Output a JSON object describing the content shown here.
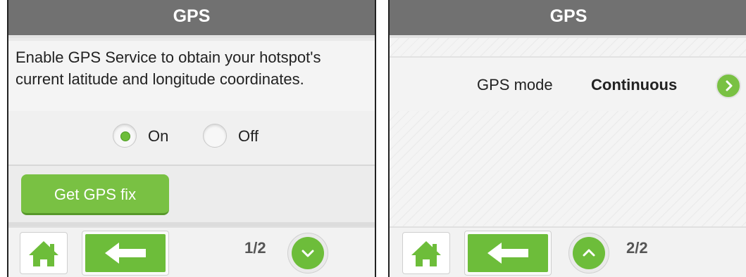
{
  "accent_color": "#6dbd3a",
  "screens": [
    {
      "title": "GPS",
      "description": "Enable GPS Service to obtain your hotspot's current latitude and longitude coordinates.",
      "radio_on_label": "On",
      "radio_off_label": "Off",
      "selected": "On",
      "fix_button_label": "Get GPS fix",
      "page_indicator": "1/2",
      "footer_icons": [
        "home-icon",
        "back-arrow-icon",
        "chevron-down-icon"
      ]
    },
    {
      "title": "GPS",
      "mode_label": "GPS mode",
      "mode_value": "Continuous",
      "page_indicator": "2/2",
      "footer_icons": [
        "home-icon",
        "back-arrow-icon",
        "chevron-up-icon"
      ]
    }
  ]
}
